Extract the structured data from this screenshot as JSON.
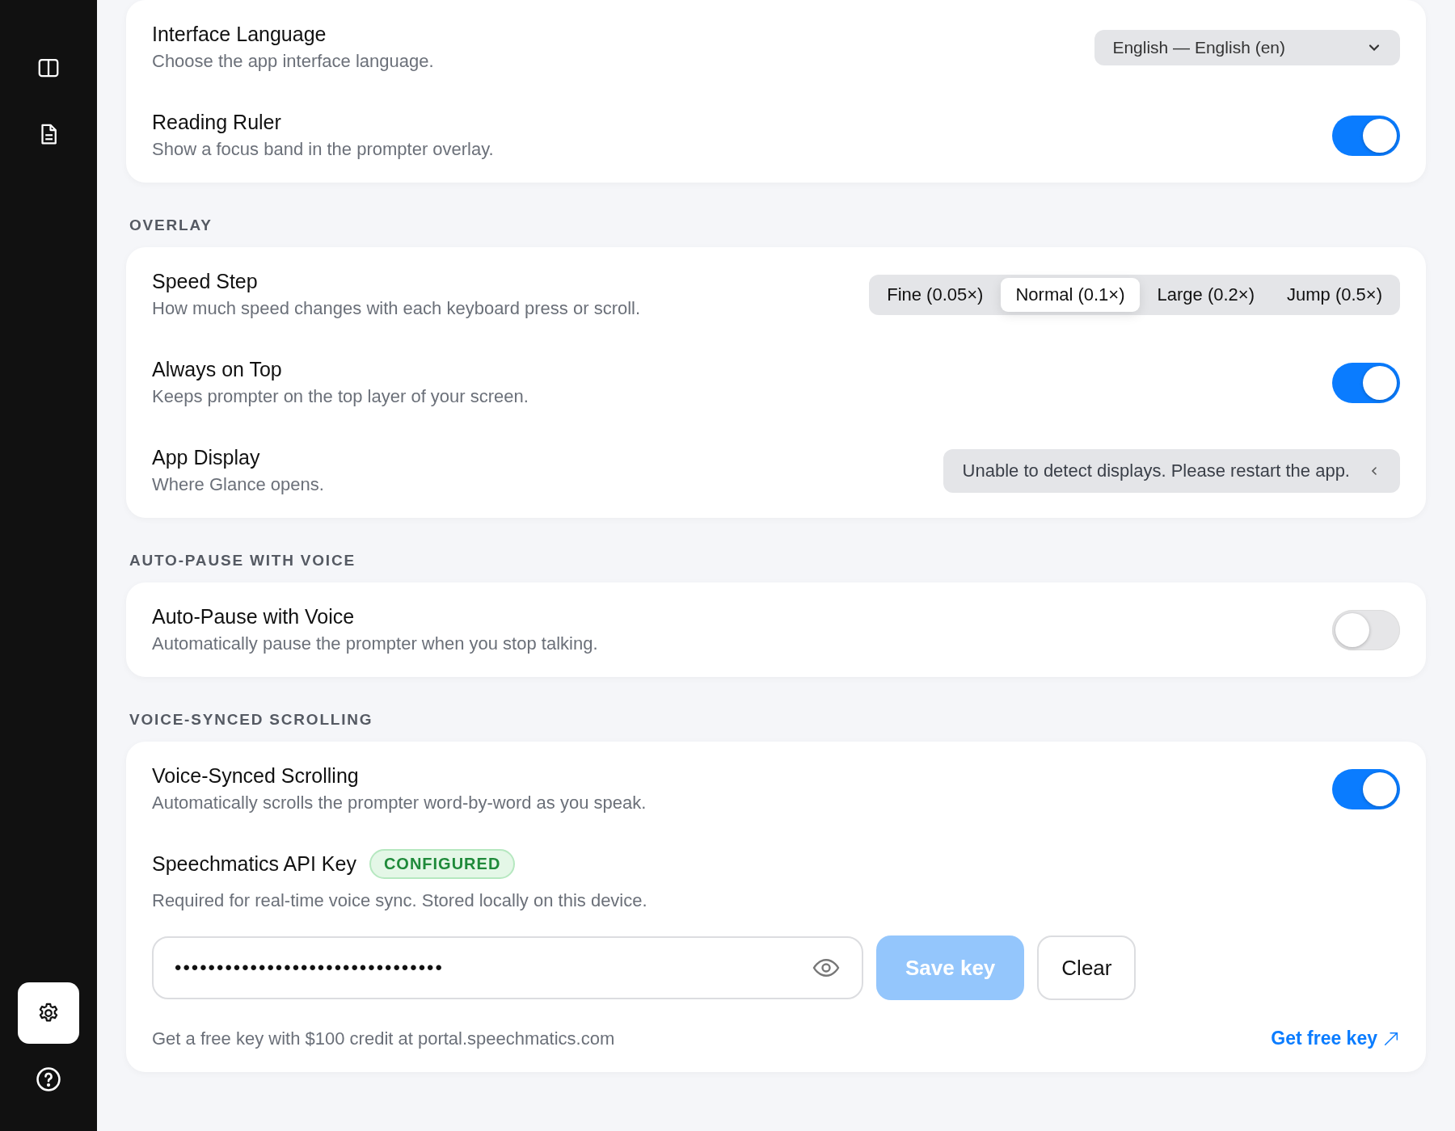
{
  "sidebar": {
    "top_items": [
      {
        "kind": "panels",
        "selected": false
      },
      {
        "kind": "document",
        "selected": false
      }
    ],
    "bottom_items": [
      {
        "kind": "settings",
        "selected": true
      },
      {
        "kind": "help",
        "selected": false
      }
    ]
  },
  "sections": [
    {
      "rows": [
        {
          "kind": "select",
          "title": "Interface Language",
          "description": "Choose the app interface language.",
          "value": "English — English (en)"
        },
        {
          "kind": "toggle",
          "title": "Reading Ruler",
          "description": "Show a focus band in the prompter overlay.",
          "on": true
        }
      ]
    },
    {
      "heading": "OVERLAY",
      "rows": [
        {
          "kind": "segmented",
          "title": "Speed Step",
          "description": "How much speed changes with each keyboard press or scroll.",
          "options": [
            {
              "label": "Fine (0.05×)",
              "selected": false
            },
            {
              "label": "Normal (0.1×)",
              "selected": true
            },
            {
              "label": "Large (0.2×)",
              "selected": false
            },
            {
              "label": "Jump (0.5×)",
              "selected": false
            }
          ]
        },
        {
          "kind": "toggle",
          "title": "Always on Top",
          "description": "Keeps prompter on the top layer of your screen.",
          "on": true
        },
        {
          "kind": "notice",
          "title": "App Display",
          "description": "Where Glance opens.",
          "value": "Unable to detect displays. Please restart the app."
        }
      ]
    },
    {
      "heading": "AUTO-PAUSE WITH VOICE",
      "rows": [
        {
          "kind": "toggle",
          "title": "Auto-Pause with Voice",
          "description": "Automatically pause the prompter when you stop talking.",
          "on": false
        }
      ]
    },
    {
      "heading": "VOICE-SYNCED SCROLLING",
      "rows": [
        {
          "kind": "toggle",
          "title": "Voice-Synced Scrolling",
          "description": "Automatically scrolls the prompter word-by-word as you speak.",
          "on": true
        },
        {
          "kind": "apikey",
          "title": "Speechmatics API Key",
          "badge": "CONFIGURED",
          "description": "Required for real-time voice sync. Stored locally on this device.",
          "value": "••••••••••••••••••••••••••••••••",
          "save_button": {
            "label": "Save key",
            "disabled": true
          },
          "clear_button": {
            "label": "Clear"
          },
          "note": "Get a free key with $100 credit at portal.speechmatics.com",
          "link": "Get free key"
        }
      ]
    }
  ]
}
